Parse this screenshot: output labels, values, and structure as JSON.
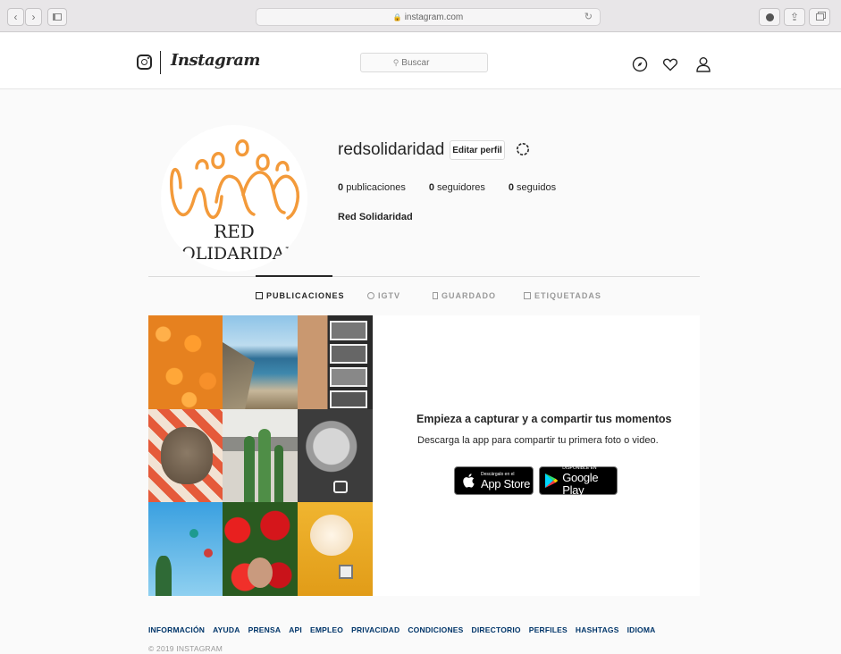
{
  "browser": {
    "url": "instagram.com"
  },
  "header": {
    "brand": "Instagram",
    "search_placeholder": "Buscar"
  },
  "profile": {
    "username": "redsolidaridad",
    "edit_label": "Editar perfil",
    "posts": "0",
    "posts_label": "publicaciones",
    "followers": "0",
    "followers_label": "seguidores",
    "following": "0",
    "following_label": "seguidos",
    "full_name": "Red Solidaridad",
    "avatar_text_line1": "RED",
    "avatar_text_line2": "SOLIDARIDAD"
  },
  "tabs": [
    {
      "label": "PUBLICACIONES",
      "active": true
    },
    {
      "label": "IGTV",
      "active": false
    },
    {
      "label": "GUARDADO",
      "active": false
    },
    {
      "label": "ETIQUETADAS",
      "active": false
    }
  ],
  "promo": {
    "title": "Empieza a capturar y a compartir tus momentos",
    "subtitle": "Descarga la app para compartir tu primera foto o video.",
    "appstore_small": "Descárgalo en el",
    "appstore_big": "App Store",
    "googleplay_small": "DISPONIBLE EN",
    "googleplay_big": "Google Play"
  },
  "footer": {
    "links": [
      "INFORMACIÓN",
      "AYUDA",
      "PRENSA",
      "API",
      "EMPLEO",
      "PRIVACIDAD",
      "CONDICIONES",
      "DIRECTORIO",
      "PERFILES",
      "HASHTAGS",
      "IDIOMA"
    ],
    "copyright": "© 2019 INSTAGRAM"
  },
  "colors": {
    "brand_orange": "#f39a3a",
    "link_blue": "#003569",
    "text_dark": "#262626"
  }
}
